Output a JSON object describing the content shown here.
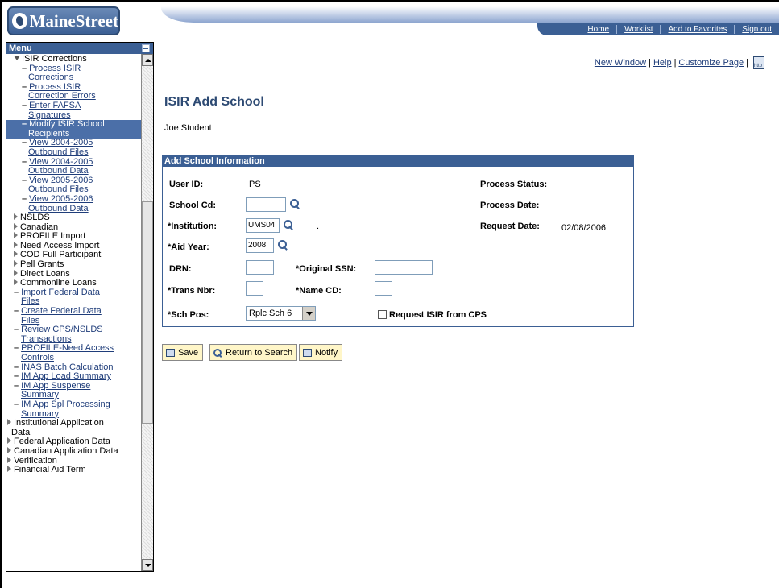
{
  "header": {
    "logo_text": "MaineStreet",
    "nav": [
      "Home",
      "Worklist",
      "Add to Favorites",
      "Sign out"
    ]
  },
  "menu": {
    "title": "Menu",
    "items": [
      {
        "label": "ISIR Corrections",
        "type": "folder-open"
      },
      {
        "label": "Process ISIR Corrections",
        "type": "link"
      },
      {
        "label": "Process ISIR Correction Errors",
        "type": "link"
      },
      {
        "label": "Enter FAFSA Signatures",
        "type": "link"
      },
      {
        "label": "Modify ISIR School Recipients",
        "type": "selected"
      },
      {
        "label": "View 2004-2005 Outbound Files",
        "type": "link"
      },
      {
        "label": "View 2004-2005 Outbound Data",
        "type": "link"
      },
      {
        "label": "View 2005-2006 Outbound Files",
        "type": "link"
      },
      {
        "label": "View 2005-2006 Outbound Data",
        "type": "link"
      },
      {
        "label": "NSLDS",
        "type": "folder"
      },
      {
        "label": "Canadian",
        "type": "folder"
      },
      {
        "label": "PROFILE Import",
        "type": "folder"
      },
      {
        "label": "Need Access Import",
        "type": "folder"
      },
      {
        "label": "COD Full Participant",
        "type": "folder"
      },
      {
        "label": "Pell Grants",
        "type": "folder"
      },
      {
        "label": "Direct Loans",
        "type": "folder"
      },
      {
        "label": "Commonline Loans",
        "type": "folder"
      },
      {
        "label": "Import Federal Data Files",
        "type": "link"
      },
      {
        "label": "Create Federal Data Files",
        "type": "link"
      },
      {
        "label": "Review CPS/NSLDS Transactions",
        "type": "link"
      },
      {
        "label": "PROFILE-Need Access Controls",
        "type": "link"
      },
      {
        "label": "INAS Batch Calculation",
        "type": "link"
      },
      {
        "label": "IM App Load Summary",
        "type": "link"
      },
      {
        "label": "IM App Suspense Summary",
        "type": "link"
      },
      {
        "label": "IM App Spl Processing Summary",
        "type": "link"
      },
      {
        "label": "Institutional Application Data",
        "type": "root"
      },
      {
        "label": "Federal Application Data",
        "type": "root"
      },
      {
        "label": "Canadian Application Data",
        "type": "root"
      },
      {
        "label": "Verification",
        "type": "root"
      },
      {
        "label": "Financial Aid Term",
        "type": "root"
      }
    ]
  },
  "toplinks": {
    "new_window": "New Window",
    "help": "Help",
    "customize": "Customize Page"
  },
  "page": {
    "title": "ISIR Add School",
    "student": "Joe Student"
  },
  "panel": {
    "title": "Add School Information",
    "user_id_label": "User ID:",
    "user_id_value": "PS",
    "school_cd_label": "School Cd:",
    "school_cd_value": "",
    "institution_label": "*Institution:",
    "institution_value": "UMS04",
    "institution_desc": ".",
    "aid_year_label": "*Aid Year:",
    "aid_year_value": "2008",
    "drn_label": "DRN:",
    "drn_value": "",
    "orig_ssn_label": "*Original SSN:",
    "orig_ssn_value": "",
    "trans_nbr_label": "*Trans Nbr:",
    "trans_nbr_value": "",
    "name_cd_label": "*Name CD:",
    "name_cd_value": "",
    "sch_pos_label": "*Sch Pos:",
    "sch_pos_value": "Rplc Sch 6",
    "process_status_label": "Process Status:",
    "process_date_label": "Process Date:",
    "request_date_label": "Request Date:",
    "request_date_value": "02/08/2006",
    "request_isir_label": "Request ISIR from CPS"
  },
  "buttons": {
    "save": "Save",
    "return": "Return to Search",
    "notify": "Notify"
  }
}
